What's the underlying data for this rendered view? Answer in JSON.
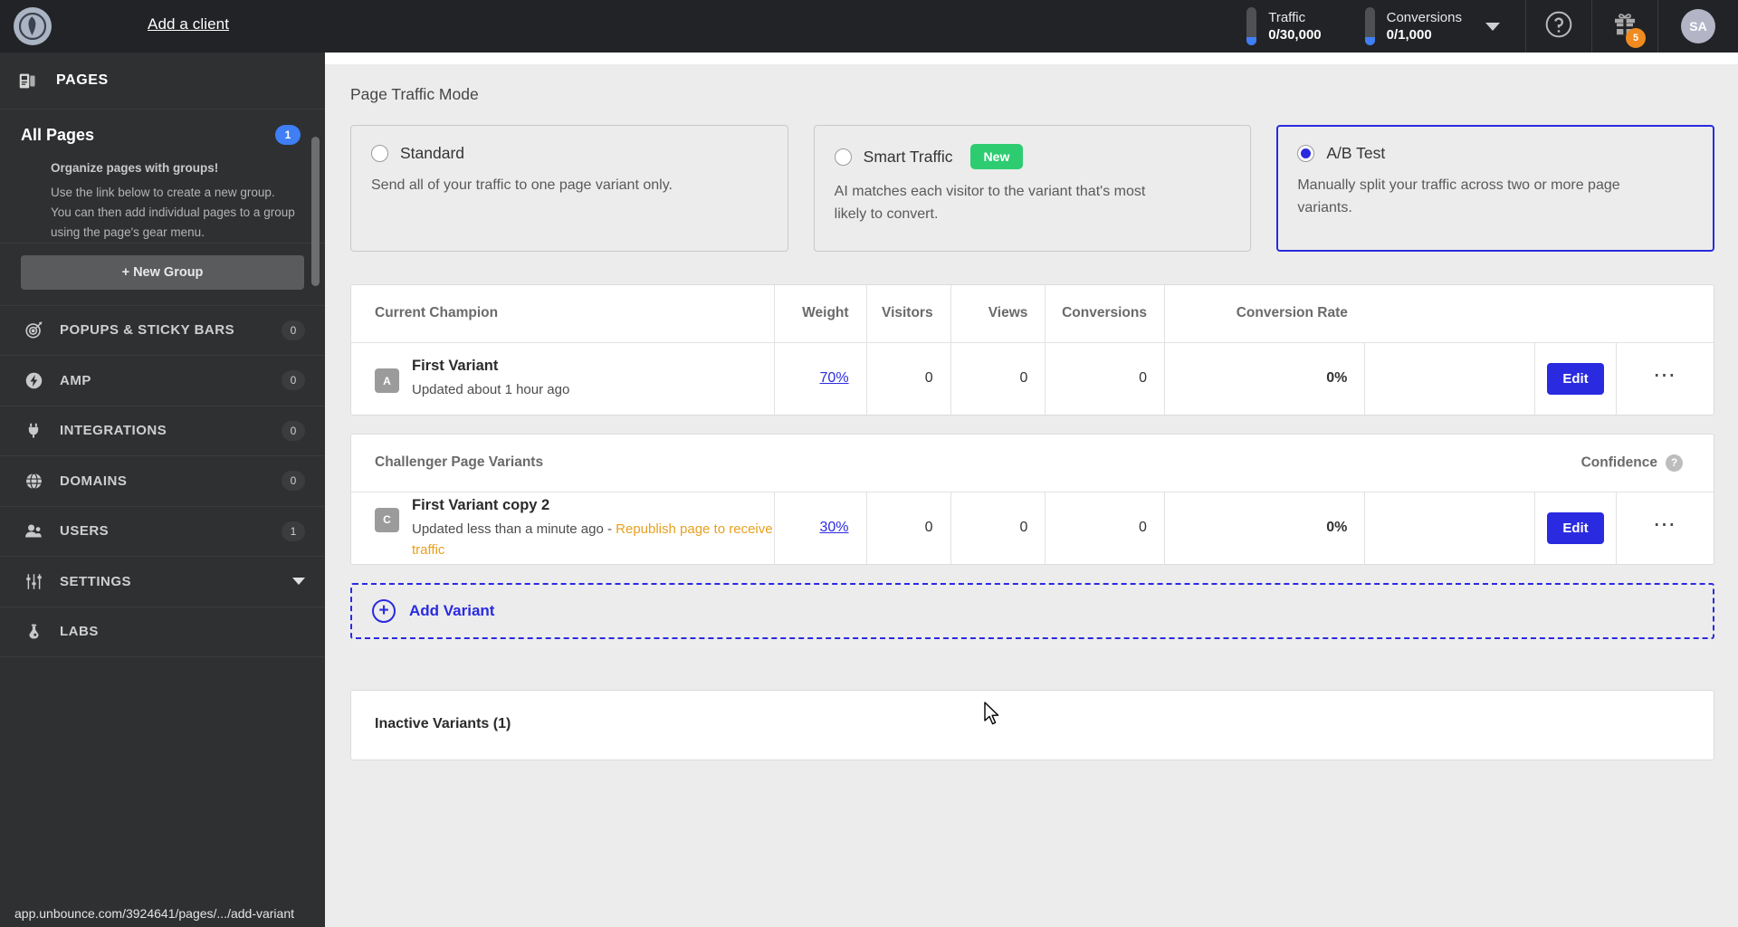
{
  "sidebar": {
    "add_client": "Add a client",
    "logo_icon": "unbounce-logo-icon",
    "pages_section": {
      "label": "PAGES",
      "icon": "pages-icon"
    },
    "all_pages": {
      "label": "All Pages",
      "count": "1"
    },
    "group_tip": {
      "title": "Organize pages with groups!",
      "body": "Use the link below to create a new group. You can then add individual pages to a group using the page's gear menu."
    },
    "new_group_button": "+ New Group",
    "items": [
      {
        "label": "POPUPS & STICKY BARS",
        "count": "0",
        "icon": "target-icon"
      },
      {
        "label": "AMP",
        "count": "0",
        "icon": "bolt-icon"
      },
      {
        "label": "INTEGRATIONS",
        "count": "0",
        "icon": "plug-icon"
      },
      {
        "label": "DOMAINS",
        "count": "0",
        "icon": "globe-icon"
      },
      {
        "label": "USERS",
        "count": "1",
        "icon": "users-icon"
      },
      {
        "label": "SETTINGS",
        "count": "",
        "icon": "sliders-icon",
        "caret": true
      },
      {
        "label": "LABS",
        "count": "",
        "icon": "flask-icon"
      }
    ]
  },
  "topbar": {
    "traffic": {
      "label": "Traffic",
      "value": "0/30,000"
    },
    "conversions": {
      "label": "Conversions",
      "value": "0/1,000"
    },
    "caret_icon": "chevron-down-icon",
    "help_icon": "help-circle-icon",
    "gift_icon": "gift-icon",
    "gift_badge": "5",
    "avatar_initials": "SA"
  },
  "main": {
    "section_title": "Page Traffic Mode",
    "modes": [
      {
        "name": "Standard",
        "desc": "Send all of your traffic to one page variant only.",
        "selected": false,
        "badge": ""
      },
      {
        "name": "Smart Traffic",
        "desc": "AI matches each visitor to the variant that's most likely to convert.",
        "selected": false,
        "badge": "New"
      },
      {
        "name": "A/B Test",
        "desc": "Manually split your traffic across two or more page variants.",
        "selected": true,
        "badge": ""
      }
    ],
    "champion_table": {
      "headers": {
        "lead": "Current Champion",
        "weight": "Weight",
        "visitors": "Visitors",
        "views": "Views",
        "conversions": "Conversions",
        "conversion_rate": "Conversion Rate"
      },
      "row": {
        "letter": "A",
        "name": "First Variant",
        "sub": "Updated about 1 hour ago",
        "weight": "70%",
        "visitors": "0",
        "views": "0",
        "conversions": "0",
        "conversion_rate": "0%",
        "edit": "Edit",
        "more_icon": "more-horizontal-icon"
      }
    },
    "challenger_table": {
      "headers": {
        "lead": "Challenger Page Variants",
        "confidence": "Confidence"
      },
      "confidence_help_icon": "help-circle-icon",
      "row": {
        "letter": "C",
        "name": "First Variant copy 2",
        "sub_prefix": "Updated less than a minute ago - ",
        "sub_warning": "Republish page to receive traffic",
        "weight": "30%",
        "visitors": "0",
        "views": "0",
        "conversions": "0",
        "conversion_rate": "0%",
        "edit": "Edit",
        "more_icon": "more-horizontal-icon"
      }
    },
    "add_variant": {
      "label": "Add Variant",
      "icon": "plus-circle-icon"
    },
    "inactive_variants_title": "Inactive Variants (1)"
  },
  "statusbar": {
    "url": "app.unbounce.com/3924641/pages/.../add-variant"
  },
  "colors": {
    "accent_blue": "#2a2ae0",
    "badge_blue": "#3f7ef4",
    "green_new": "#2ecc71",
    "warning_orange": "#e8a020",
    "gift_orange": "#ef8b1f",
    "sidebar_bg": "#2f3032",
    "topbar_bg": "#222326",
    "content_bg": "#ececec"
  }
}
